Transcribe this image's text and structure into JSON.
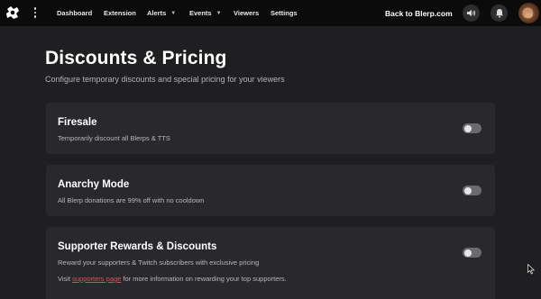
{
  "nav": {
    "items": [
      {
        "label": "Dashboard"
      },
      {
        "label": "Extension"
      },
      {
        "label": "Alerts",
        "has_caret": true
      },
      {
        "label": "Events",
        "has_caret": true
      },
      {
        "label": "Viewers"
      },
      {
        "label": "Settings"
      }
    ],
    "back_label": "Back to Blerp.com",
    "icons": [
      "blerp-logo-icon",
      "kebab-menu-icon",
      "sound-icon",
      "bell-icon",
      "avatar"
    ]
  },
  "page": {
    "title": "Discounts & Pricing",
    "subtitle": "Configure temporary discounts and special pricing for your viewers"
  },
  "cards": [
    {
      "title": "Firesale",
      "description": "Temporarily discount all Blerps & TTS",
      "enabled": false
    },
    {
      "title": "Anarchy Mode",
      "description": "All Blerp donations are 99% off with no cooldown",
      "enabled": false
    },
    {
      "title": "Supporter Rewards & Discounts",
      "description": "Reward your supporters & Twitch subscribers with exclusive pricing",
      "note_before": "Visit ",
      "note_link": "supporters page",
      "note_after": " for more information on rewarding your top supporters.",
      "enabled": false
    }
  ],
  "colors": {
    "background": "#1f1f22",
    "topbar": "#0b0b0c",
    "card": "#29292d",
    "link": "#e4485d",
    "toggle_off": "#6a6a6f"
  }
}
